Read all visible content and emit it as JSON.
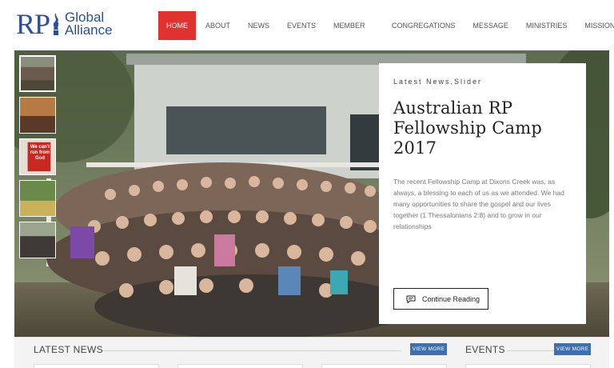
{
  "logo": {
    "rp": "RP",
    "line1": "Global",
    "line2": "Alliance"
  },
  "nav": {
    "items": [
      {
        "label": "HOME",
        "active": true
      },
      {
        "label": "ABOUT",
        "active": false
      },
      {
        "label": "NEWS",
        "active": false
      },
      {
        "label": "EVENTS",
        "active": false
      },
      {
        "label": "MEMBER CHURCHES",
        "active": false
      },
      {
        "label": "CONGREGATIONS",
        "active": false
      },
      {
        "label": "MESSAGE",
        "active": false
      },
      {
        "label": "MINISTRIES",
        "active": false
      },
      {
        "label": "MISSIONS",
        "active": false
      }
    ]
  },
  "slider": {
    "category": "Latest News,Slider",
    "title": "Australian RP Fellowship Camp 2017",
    "excerpt": "The recent Fellowship Camp at Dixons Creek was, as always, a blessing to each of us as we attended. We had many opportunities to share the gospel and our lives together (1 Thessalonians 2:8) and to grow in our relationships",
    "button_label": "Continue Reading",
    "button_icon": "comment-icon",
    "thumb_sign_text": "We can't run from God"
  },
  "sections": {
    "news": {
      "title": "LATEST NEWS",
      "view_more": "VIEW MORE"
    },
    "events": {
      "title": "EVENTS",
      "view_more": "VIEW MORE"
    }
  },
  "colors": {
    "accent": "#e03330",
    "brand": "#2b4f9e",
    "button": "#3d6fb1"
  }
}
